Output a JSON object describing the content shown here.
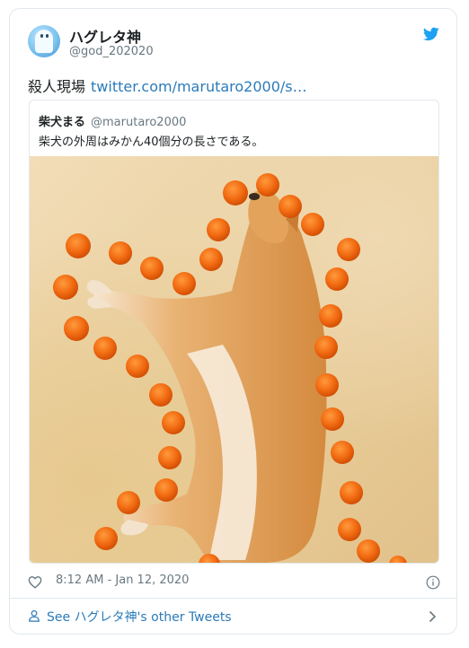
{
  "author": {
    "name": "ハグレタ神",
    "handle": "@god_202020"
  },
  "tweet": {
    "text": "殺人現場",
    "link_text": "twitter.com/marutaro2000/s…"
  },
  "quoted_tweet": {
    "name": "柴犬まる",
    "handle": "@marutaro2000",
    "text": "柴犬の外周はみかん40個分の長さである。"
  },
  "footer": {
    "timestamp": "8:12 AM - Jan 12, 2020"
  },
  "see_more": {
    "label": "See ハグレタ神's other Tweets"
  },
  "colors": {
    "link": "#2b7bb9",
    "twitter_blue": "#1da1f2",
    "secondary_text": "#697882",
    "border": "#e1e8ed"
  },
  "icons": [
    "twitter-bird-icon",
    "heart-icon",
    "info-icon",
    "person-icon",
    "chevron-right-icon"
  ]
}
